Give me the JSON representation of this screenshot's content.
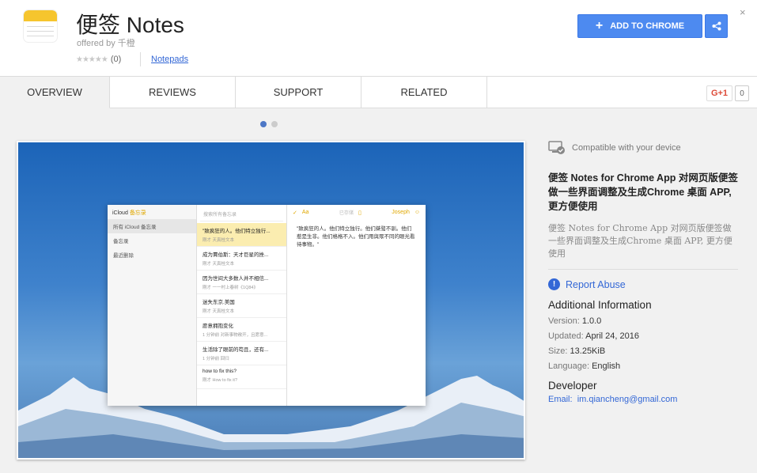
{
  "header": {
    "title": "便签 Notes",
    "offered_by": "offered by 千橙",
    "rating_count": "(0)",
    "category": "Notepads",
    "add_button": "ADD TO CHROME",
    "close": "×"
  },
  "tabs": [
    {
      "label": "OVERVIEW"
    },
    {
      "label": "REVIEWS"
    },
    {
      "label": "SUPPORT"
    },
    {
      "label": "RELATED"
    }
  ],
  "gplus": {
    "label": "G+1",
    "count": "0"
  },
  "screenshot": {
    "sidebar_header": "iCloud",
    "sidebar_header_accent": "备忘录",
    "sidebar_items": [
      "所有 iCloud 备忘录",
      "备忘录",
      "最近删除"
    ],
    "search_placeholder": "搜索所有备忘录",
    "notes": [
      {
        "title": "\"致疯狂的人。他们特立独行...",
        "meta": "刚才  天真桂文本"
      },
      {
        "title": "成为賈伯斯：天才巨星的挫...",
        "meta": "刚才  天真桂文本"
      },
      {
        "title": "因为世间大多数人并不相信...",
        "meta": "刚才  一一村上春树《1Q84》"
      },
      {
        "title": "迷失东京.美国",
        "meta": "刚才  天真桂文本"
      },
      {
        "title": "愿意拥抱变化",
        "meta": "1 分钟前  对新事物敞开，且愿意..."
      },
      {
        "title": "生活除了眼前的苟且，还有...",
        "meta": "1 分钟前  回归"
      },
      {
        "title": "how to fix this?",
        "meta": "刚才  How to fix it?"
      }
    ],
    "toolbar_saved": "已存储",
    "toolbar_user": "Joseph",
    "toolbar_aa": "Aa",
    "body_text": "\"致疯狂的人。他们特立独行。他们桀骜不驯。他们惹是生非。他们格格不入。他们用與眾不同的眼光看待事物。\""
  },
  "right": {
    "compatible": "Compatible with your device",
    "desc_title": "便签 Notes for Chrome App 对网页版便签做一些界面调整及生成Chrome 桌面 APP, 更方便使用",
    "desc_body": "便签 Notes for Chrome App 对网页版便签做一些界面调整及生成Chrome 桌面 APP, 更方便使用",
    "report_abuse": "Report Abuse",
    "additional_info": "Additional Information",
    "version_label": "Version:",
    "version": "1.0.0",
    "updated_label": "Updated:",
    "updated": "April 24, 2016",
    "size_label": "Size:",
    "size": "13.25KiB",
    "language_label": "Language:",
    "language": "English",
    "developer": "Developer",
    "email_label": "Email:",
    "email": "im.qiancheng@gmail.com"
  },
  "colors": {
    "accent": "#4d8af0",
    "link": "#3367d6",
    "note_yellow": "#f6c52e"
  }
}
